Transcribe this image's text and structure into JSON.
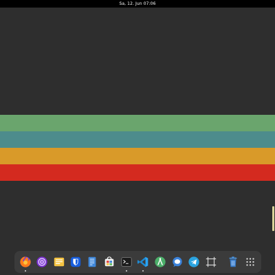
{
  "topbar": {
    "clock": "Sa, 12. Jun  07:06"
  },
  "wallpaper": {
    "background": "#2e2e2e",
    "stripes": [
      "#6aa56d",
      "#4d8c8c",
      "#d99a29",
      "#d42a1f"
    ]
  },
  "dock": {
    "apps": [
      {
        "icon": "firefox-icon",
        "running": true
      },
      {
        "icon": "podcasts-icon",
        "running": false
      },
      {
        "icon": "mail-icon",
        "running": false
      },
      {
        "icon": "bitwarden-icon",
        "running": false
      },
      {
        "icon": "file-manager-icon",
        "running": false
      },
      {
        "icon": "software-store-icon",
        "running": false
      },
      {
        "icon": "terminal-icon",
        "running": true
      },
      {
        "icon": "vscode-icon",
        "running": true
      },
      {
        "icon": "android-studio-icon",
        "running": false
      },
      {
        "icon": "chat-icon",
        "running": false
      },
      {
        "icon": "telegram-icon",
        "running": false
      },
      {
        "icon": "screenshot-icon",
        "running": false
      },
      {
        "icon": "trash-icon",
        "running": false
      },
      {
        "icon": "app-grid-icon",
        "running": false
      }
    ]
  }
}
